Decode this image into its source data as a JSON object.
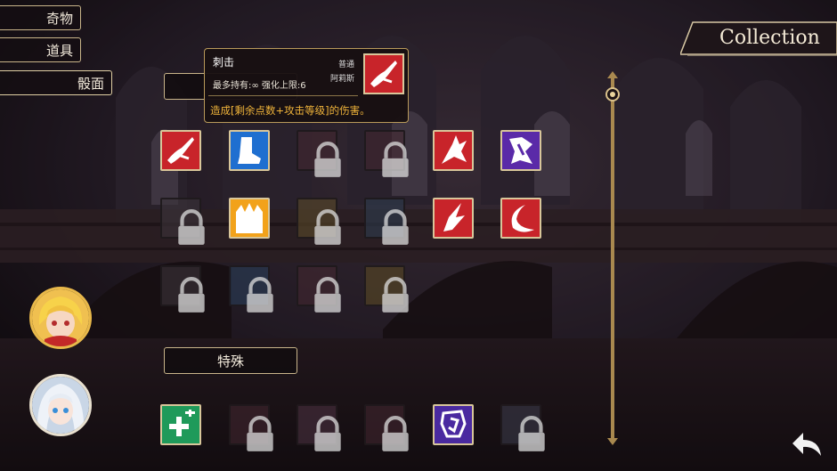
{
  "categories": [
    {
      "label": "奇物"
    },
    {
      "label": "道具"
    },
    {
      "label": "骰面"
    }
  ],
  "header": {
    "title": "Collection"
  },
  "sections": {
    "top_label": "",
    "special_label": "特殊"
  },
  "tooltip": {
    "name": "刺击",
    "rarity": "普通",
    "owner": "阿莉斯",
    "stats": "最多持有:∞ 强化上限:6",
    "description": "造成[剩余点数+攻击等级]的伤害。",
    "icon": "stab-skill-icon"
  },
  "cards": {
    "row1": [
      {
        "icon": "stab-skill-icon",
        "state": "unlocked",
        "color": "#c8242a"
      },
      {
        "icon": "boot-skill-icon",
        "state": "unlocked",
        "color": "#1f6fd0"
      },
      {
        "icon": "lock-icon",
        "state": "locked",
        "color": "#5a2b35"
      },
      {
        "icon": "lock-icon",
        "state": "locked",
        "color": "#5a2230"
      },
      {
        "icon": "slash-burst-skill-icon",
        "state": "unlocked",
        "color": "#c8242a"
      },
      {
        "icon": "dark-strike-skill-icon",
        "state": "unlocked",
        "color": "#5a2aa8"
      }
    ],
    "row2": [
      {
        "icon": "lock-icon",
        "state": "locked",
        "color": "#3a3036"
      },
      {
        "icon": "flame-skill-icon",
        "state": "unlocked",
        "color": "#f2a21a"
      },
      {
        "icon": "lock-icon",
        "state": "locked",
        "color": "#5a4a2a"
      },
      {
        "icon": "lock-icon",
        "state": "locked",
        "color": "#2e3c4e"
      },
      {
        "icon": "rend-skill-icon",
        "state": "unlocked",
        "color": "#c8242a"
      },
      {
        "icon": "crescent-skill-icon",
        "state": "unlocked",
        "color": "#c8242a"
      }
    ],
    "row3": [
      {
        "icon": "lock-icon",
        "state": "locked",
        "color": "#3a3036"
      },
      {
        "icon": "lock-icon",
        "state": "locked",
        "color": "#2a3e58"
      },
      {
        "icon": "lock-icon",
        "state": "locked",
        "color": "#5a2b35"
      },
      {
        "icon": "lock-icon",
        "state": "locked",
        "color": "#5a4a24"
      }
    ],
    "special_row": [
      {
        "icon": "heal-plus-skill-icon",
        "state": "unlocked",
        "color": "#1f9a5a"
      },
      {
        "icon": "lock-icon",
        "state": "locked",
        "color": "#5a2b35"
      },
      {
        "icon": "lock-icon",
        "state": "locked",
        "color": "#4a3040"
      },
      {
        "icon": "lock-icon",
        "state": "locked",
        "color": "#5a2b35"
      },
      {
        "icon": "rune-skill-icon",
        "state": "unlocked",
        "color": "#4a2aa0"
      },
      {
        "icon": "lock-icon",
        "state": "locked",
        "color": "#3a3a4a"
      }
    ]
  },
  "avatars": [
    {
      "name": "blonde-heroine-avatar",
      "ring": "#e8b84a"
    },
    {
      "name": "silver-hair-heroine-avatar",
      "ring": "#e8e0cf"
    }
  ],
  "controls": {
    "back": "back-arrow-icon"
  }
}
